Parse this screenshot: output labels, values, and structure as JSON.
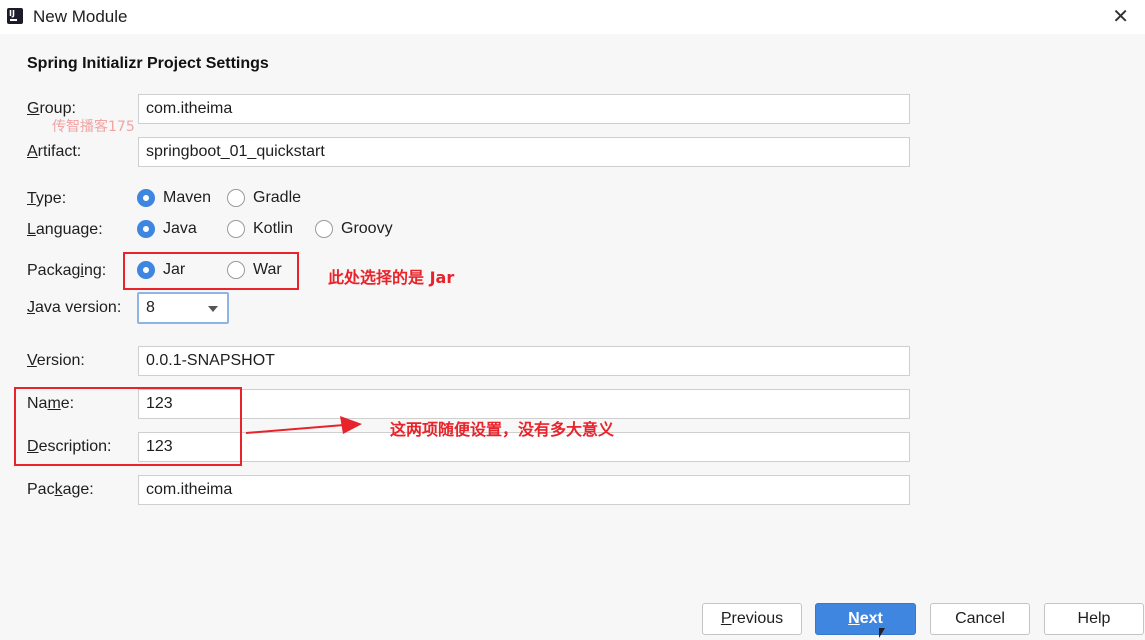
{
  "window": {
    "title": "New Module"
  },
  "section_title": "Spring Initializr Project Settings",
  "watermark": "传智播客175",
  "form": {
    "group": {
      "label_u": "G",
      "label_rest": "roup:",
      "value": "com.itheima"
    },
    "artifact": {
      "label_u": "A",
      "label_rest": "rtifact:",
      "value": "springboot_01_quickstart"
    },
    "type": {
      "label_u": "T",
      "label_rest": "ype:",
      "options": [
        "Maven",
        "Gradle"
      ],
      "selected": "Maven"
    },
    "language": {
      "label_u": "L",
      "label_rest": "anguage:",
      "options": [
        "Java",
        "Kotlin",
        "Groovy"
      ],
      "selected": "Java"
    },
    "packaging": {
      "label_pre": "Packag",
      "label_u": "i",
      "label_rest": "ng:",
      "options": [
        "Jar",
        "War"
      ],
      "selected": "Jar"
    },
    "java_version": {
      "label_u": "J",
      "label_rest": "ava version:",
      "value": "8"
    },
    "version": {
      "label_u": "V",
      "label_rest": "ersion:",
      "value": "0.0.1-SNAPSHOT"
    },
    "name": {
      "label_pre": "Na",
      "label_u": "m",
      "label_rest": "e:",
      "value": "123"
    },
    "description": {
      "label_u": "D",
      "label_rest": "escription:",
      "value": "123"
    },
    "package": {
      "label_pre": "Pac",
      "label_u": "k",
      "label_rest": "age:",
      "value": "com.itheima"
    }
  },
  "annotations": {
    "packaging_note": "此处选择的是 Jar",
    "name_desc_note": "这两项随便设置，没有多大意义"
  },
  "buttons": {
    "previous_u": "P",
    "previous_rest": "revious",
    "next_u": "N",
    "next_rest": "ext",
    "cancel": "Cancel",
    "help": "Help"
  },
  "colors": {
    "accent": "#3e86df",
    "annotation_red": "#e8232a"
  }
}
